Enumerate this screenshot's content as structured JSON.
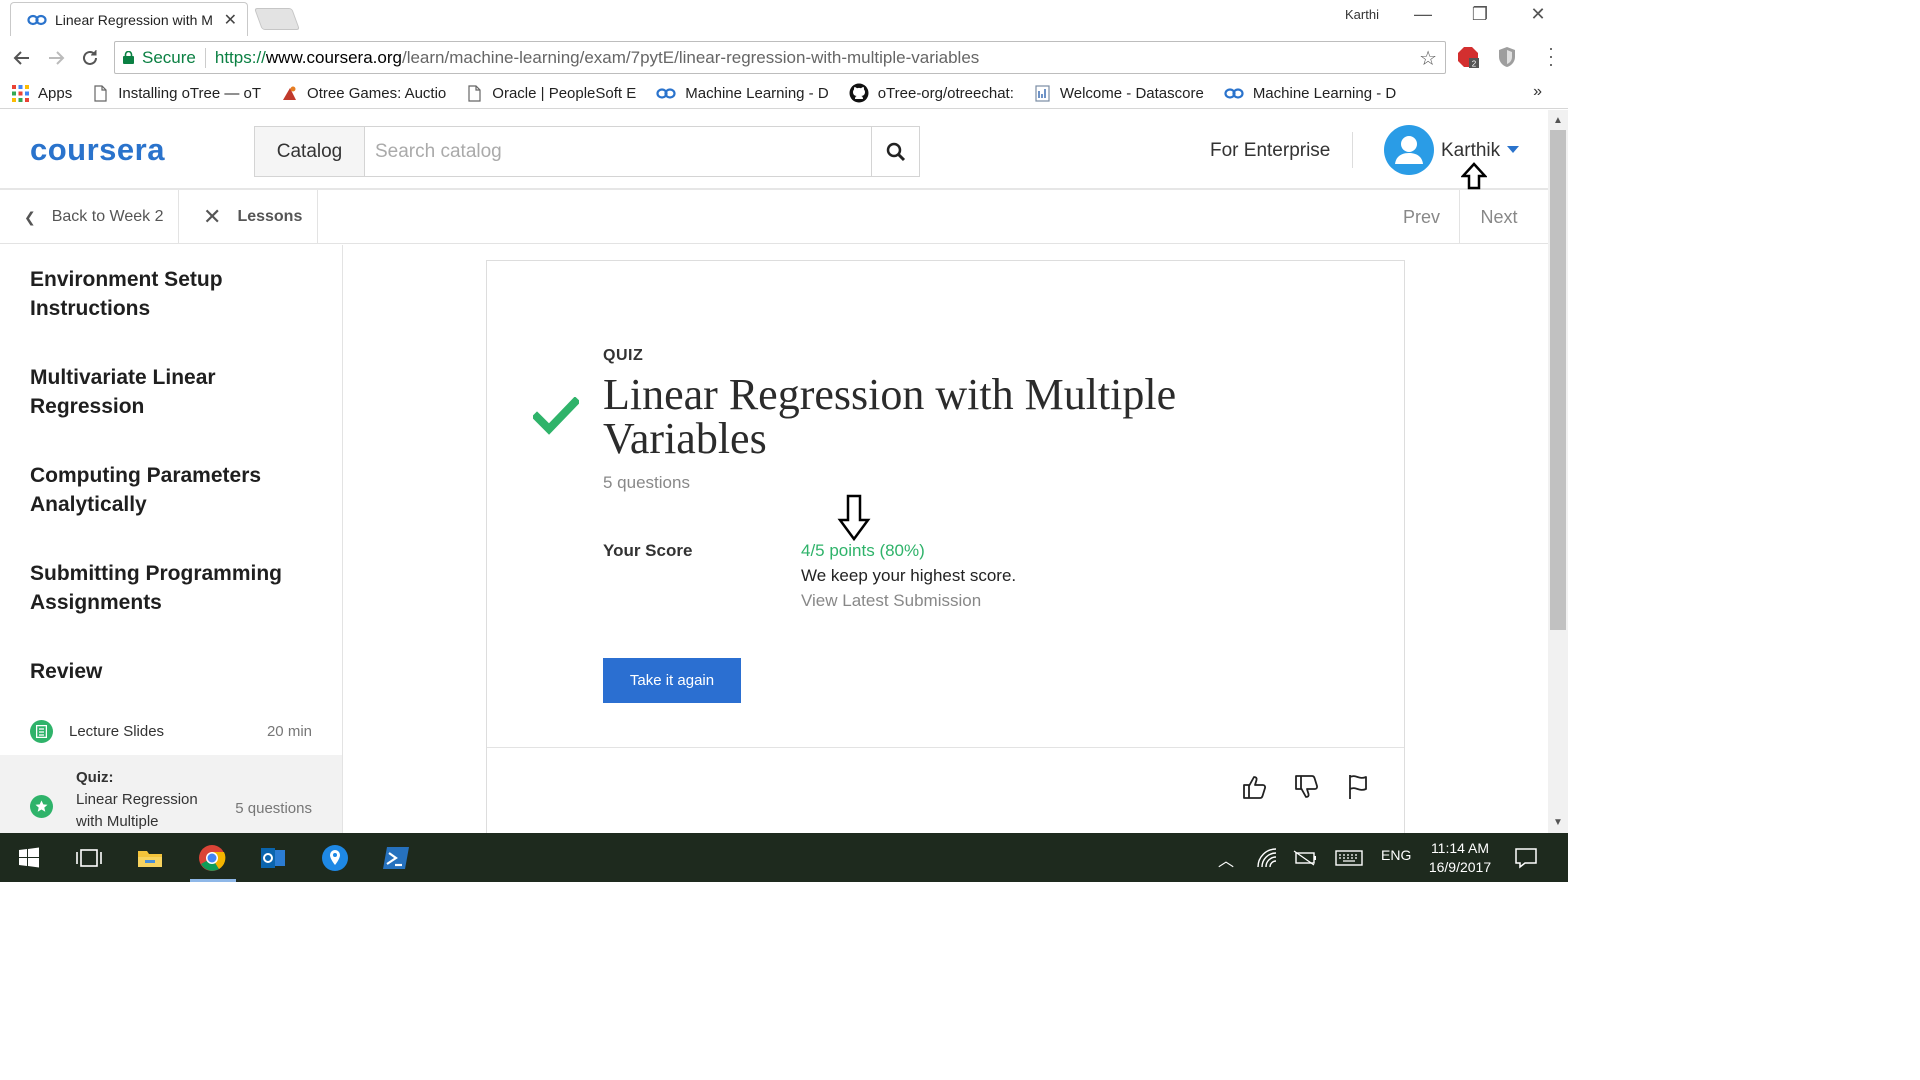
{
  "browser": {
    "tab_title": "Linear Regression with M",
    "tab_close": "✕",
    "window_user": "Karthi",
    "secure_label": "Secure",
    "url_scheme": "https://",
    "url_host": "www.coursera.org",
    "url_path": "/learn/machine-learning/exam/7pytE/linear-regression-with-multiple-variables",
    "extension_badge": "2",
    "bookmarks": [
      {
        "label": "Apps",
        "icon": "apps-grid-icon"
      },
      {
        "label": "Installing oTree — oT",
        "icon": "page-icon"
      },
      {
        "label": "Otree Games: Auctio",
        "icon": "otree-icon"
      },
      {
        "label": "Oracle | PeopleSoft E",
        "icon": "page-icon"
      },
      {
        "label": "Machine Learning - D",
        "icon": "coursera-icon"
      },
      {
        "label": "oTree-org/otreechat:",
        "icon": "github-icon"
      },
      {
        "label": "Welcome - Datascore",
        "icon": "doc-icon"
      },
      {
        "label": "Machine Learning - D",
        "icon": "coursera-icon"
      }
    ],
    "bookmarks_more": "»"
  },
  "header": {
    "logo": "coursera",
    "catalog_label": "Catalog",
    "search_placeholder": "Search catalog",
    "enterprise_label": "For Enterprise",
    "username": "Karthik"
  },
  "subnav": {
    "back_label": "Back to Week 2",
    "lessons_label": "Lessons",
    "prev_label": "Prev",
    "next_label": "Next"
  },
  "sidebar": {
    "sections": [
      "Environment Setup Instructions",
      "Multivariate Linear Regression",
      "Computing Parameters Analytically",
      "Submitting Programming Assignments",
      "Review"
    ],
    "items": [
      {
        "label": "Lecture Slides",
        "duration": "20 min"
      },
      {
        "label_prefix": "Quiz:",
        "label": "Linear Regression with Multiple",
        "duration": "5 questions"
      }
    ]
  },
  "quiz": {
    "type_label": "QUIZ",
    "title": "Linear Regression with Multiple Variables",
    "question_count": "5 questions",
    "score_label": "Your Score",
    "score_value": "4/5 points (80%)",
    "score_note": "We keep your highest score.",
    "view_submission": "View Latest Submission",
    "retake_label": "Take it again"
  },
  "taskbar": {
    "lang": "ENG",
    "time": "11:14 AM",
    "date": "16/9/2017"
  },
  "colors": {
    "brand_blue": "#2a73cc",
    "success_green": "#2fb36a",
    "button_blue": "#2b6fd1"
  }
}
